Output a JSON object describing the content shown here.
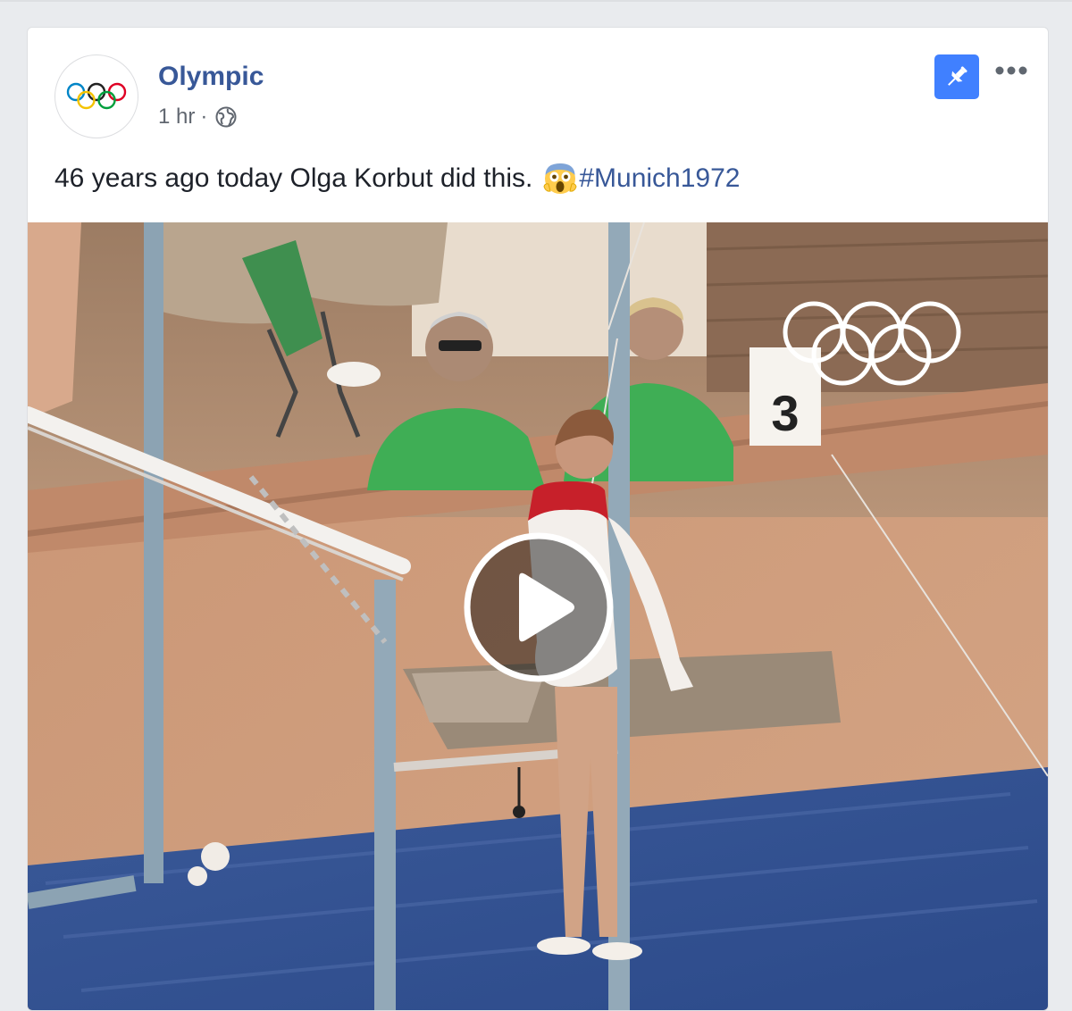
{
  "post": {
    "page_name": "Olympic",
    "timestamp": "1 hr",
    "separator": "·",
    "text": "46 years ago today Olga Korbut did this.",
    "emoji": "face-screaming-in-fear",
    "hashtag": "#Munich1972"
  },
  "video": {
    "overlay_number": "3"
  },
  "icons": {
    "avatar": "olympic-rings-logo",
    "privacy": "globe-icon",
    "pin": "pin-icon",
    "more": "more-options-icon",
    "play": "play-icon"
  },
  "colors": {
    "page_link": "#385898",
    "pin_background": "#4080ff",
    "text": "#1d2129",
    "meta_text": "#616770"
  }
}
